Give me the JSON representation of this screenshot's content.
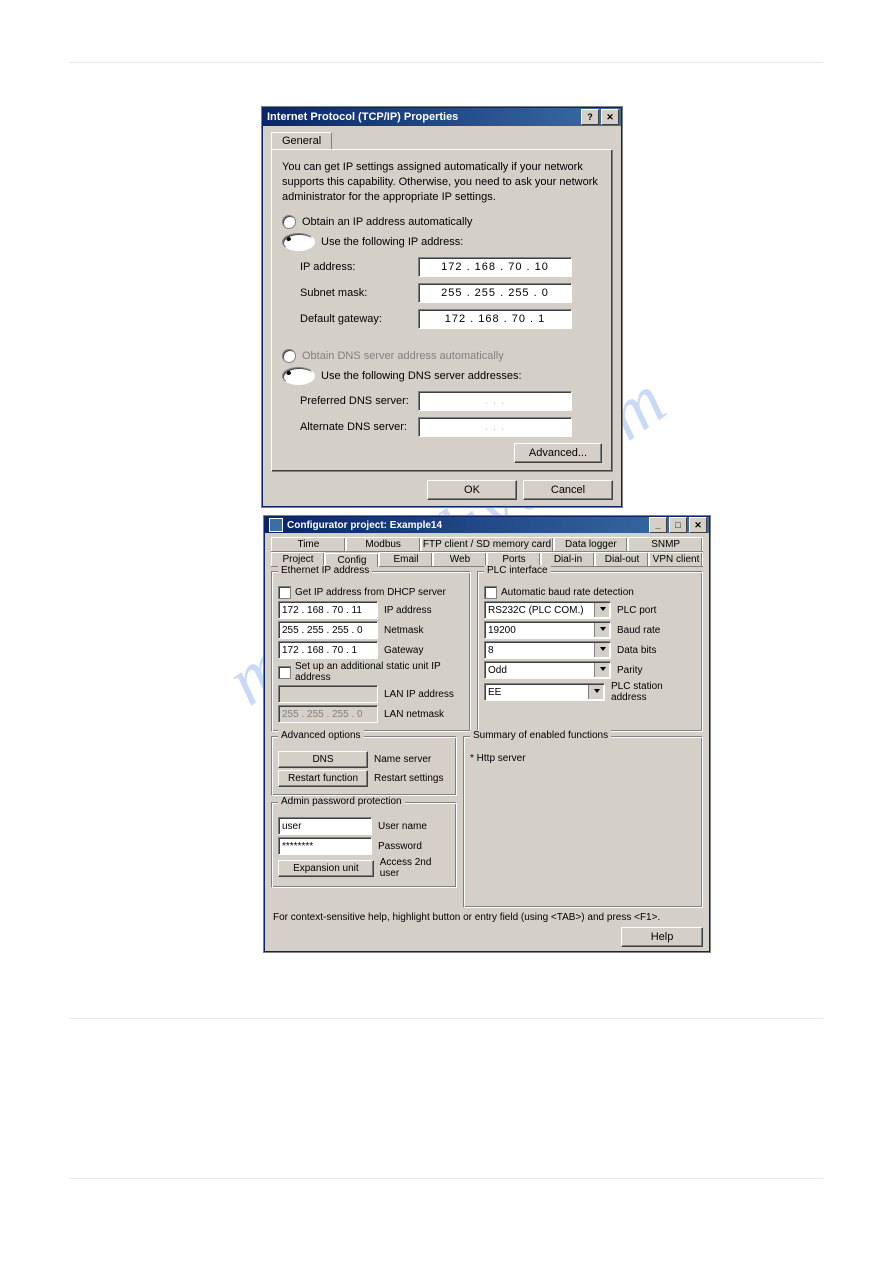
{
  "watermark": "manualslive.com",
  "tcp": {
    "title": "Internet Protocol (TCP/IP) Properties",
    "help_btn": "?",
    "close_btn": "✕",
    "tab_general": "General",
    "desc": "You can get IP settings assigned automatically if your network supports this capability. Otherwise, you need to ask your network administrator for the appropriate IP settings.",
    "r_auto_ip": "Obtain an IP address automatically",
    "r_static_ip": "Use the following IP address:",
    "ip_label": "IP address:",
    "ip_value": "172 . 168 .  70 .  10",
    "subnet_label": "Subnet mask:",
    "subnet_value": "255 . 255 . 255 .   0",
    "gw_label": "Default gateway:",
    "gw_value": "172 . 168 .  70 .   1",
    "r_auto_dns": "Obtain DNS server address automatically",
    "r_static_dns": "Use the following DNS server addresses:",
    "pref_dns_label": "Preferred DNS server:",
    "pref_dns_value": ".       .       .",
    "alt_dns_label": "Alternate DNS server:",
    "alt_dns_value": ".       .       .",
    "advanced": "Advanced...",
    "ok": "OK",
    "cancel": "Cancel"
  },
  "cfg": {
    "title": "Configurator project: Example14",
    "tabs_row1": [
      "Time",
      "Modbus",
      "FTP client / SD memory card",
      "Data logger",
      "SNMP"
    ],
    "tabs_row2": [
      "Project",
      "Config",
      "Email",
      "Web",
      "Ports",
      "Dial-in",
      "Dial-out",
      "VPN client"
    ],
    "eth": {
      "legend": "Ethernet IP address",
      "dhcp": "Get IP address from DHCP server",
      "ip": "172 . 168 .  70 .  11",
      "ip_lbl": "IP address",
      "nm": "255 . 255 . 255 .   0",
      "nm_lbl": "Netmask",
      "gw": "172 . 168 .  70 .   1",
      "gw_lbl": "Gateway",
      "addl": "Set up an additional static unit IP address",
      "lanip": "",
      "lanip_lbl": "LAN IP address",
      "lannm": "255 . 255 . 255 .   0",
      "lannm_lbl": "LAN netmask"
    },
    "plc": {
      "legend": "PLC interface",
      "auto": "Automatic baud rate detection",
      "port": "RS232C (PLC COM.)",
      "port_lbl": "PLC port",
      "baud": "19200",
      "baud_lbl": "Baud rate",
      "bits": "8",
      "bits_lbl": "Data bits",
      "parity": "Odd",
      "parity_lbl": "Parity",
      "station": "EE",
      "station_lbl": "PLC station address"
    },
    "adv": {
      "legend": "Advanced options",
      "dns": "DNS",
      "dns_lbl": "Name server",
      "restart": "Restart function",
      "restart_lbl": "Restart settings"
    },
    "sum": {
      "legend": "Summary of enabled functions",
      "line1": "* Http server"
    },
    "admin": {
      "legend": "Admin password protection",
      "user": "user",
      "user_lbl": "User name",
      "pass": "********",
      "pass_lbl": "Password",
      "exp": "Expansion unit",
      "exp_lbl": "Access 2nd user"
    },
    "status": "For context-sensitive help, highlight button or entry field (using <TAB>) and press <F1>.",
    "help": "Help"
  }
}
